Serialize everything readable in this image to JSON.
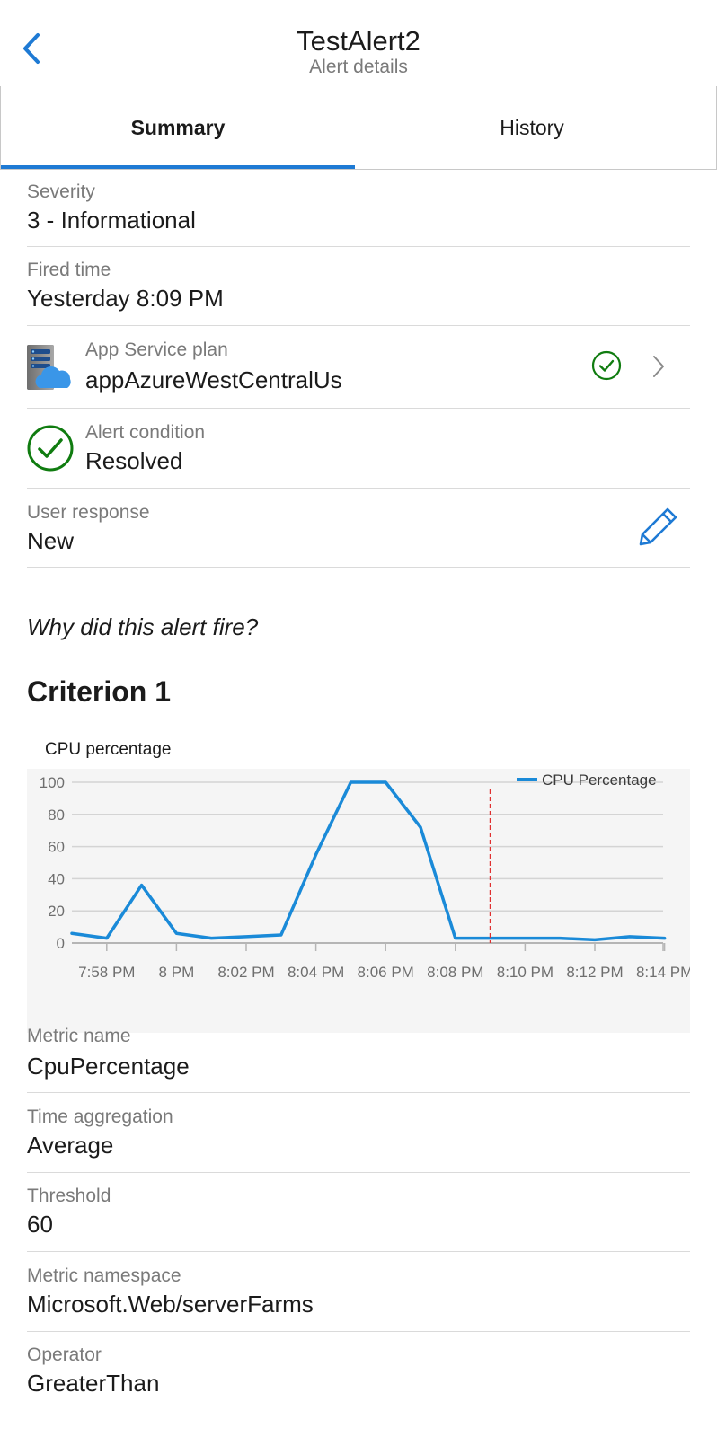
{
  "header": {
    "title": "TestAlert2",
    "subtitle": "Alert details",
    "back_icon": "chevron-left-icon"
  },
  "tabs": [
    {
      "label": "Summary",
      "selected": true
    },
    {
      "label": "History",
      "selected": false
    }
  ],
  "severity": {
    "label": "Severity",
    "value": "3 - Informational"
  },
  "fired_time": {
    "label": "Fired time",
    "value": "Yesterday 8:09 PM"
  },
  "resource": {
    "label": "App Service plan",
    "value": "appAzureWestCentralUs",
    "icon": "app-service-plan-icon",
    "status_icon": "check-circle-icon",
    "status_color": "#107c10"
  },
  "alert_condition": {
    "label": "Alert condition",
    "value": "Resolved",
    "icon": "check-circle-icon",
    "color": "#107c10"
  },
  "user_response": {
    "label": "User response",
    "value": "New",
    "edit_icon": "pencil-icon"
  },
  "why_heading": "Why did this alert fire?",
  "criterion_heading": "Criterion 1",
  "chart_title": "CPU percentage",
  "chart_data": {
    "type": "line",
    "title": "CPU percentage",
    "legend": "top-right",
    "grid": true,
    "ylim": [
      0,
      100
    ],
    "yticks": [
      0,
      20,
      40,
      60,
      80,
      100
    ],
    "xticks": [
      "7:58 PM",
      "8 PM",
      "8:02 PM",
      "8:04 PM",
      "8:06 PM",
      "8:08 PM",
      "8:10 PM",
      "8:12 PM",
      "8:14 PM"
    ],
    "xlim_minutes": [
      0,
      16.3
    ],
    "series": [
      {
        "name": "CPU Percentage",
        "color": "#1a8ad8",
        "x_minutes": [
          0,
          1,
          2,
          3,
          4,
          5,
          6,
          7,
          8,
          9,
          10,
          11,
          12,
          13,
          14,
          15,
          16,
          17
        ],
        "values": [
          6,
          3,
          36,
          6,
          3,
          4,
          5,
          55,
          100,
          100,
          72,
          3,
          3,
          3,
          3,
          2,
          4,
          3
        ]
      }
    ],
    "annotation": {
      "type": "vertical-dashed-line",
      "x_minutes": 12,
      "color": "#e03030"
    }
  },
  "metric_name": {
    "label": "Metric name",
    "value": "CpuPercentage"
  },
  "time_aggregation": {
    "label": "Time aggregation",
    "value": "Average"
  },
  "threshold": {
    "label": "Threshold",
    "value": "60"
  },
  "metric_namespace": {
    "label": "Metric namespace",
    "value": "Microsoft.Web/serverFarms"
  },
  "operator": {
    "label": "Operator",
    "value": "GreaterThan"
  }
}
